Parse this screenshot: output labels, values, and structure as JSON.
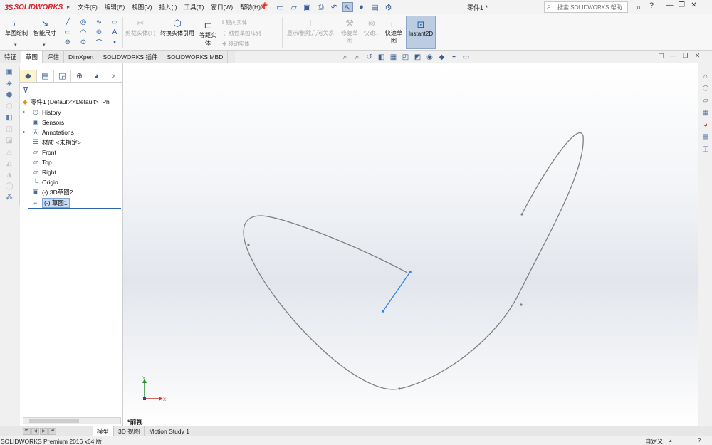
{
  "app": {
    "logo_text": "SOLIDWORKS",
    "doc_title": "零件1 *",
    "search_placeholder": "搜索 SOLIDWORKS 帮助"
  },
  "menus": [
    "文件(F)",
    "编辑(E)",
    "视图(V)",
    "插入(I)",
    "工具(T)",
    "窗口(W)",
    "帮助(H)"
  ],
  "commands": {
    "sketch": "草图绘制",
    "smart_dim": "智能尺寸",
    "trim": "剪裁实体(T)",
    "convert": "转换实体引用",
    "offset_line1": "等距实",
    "offset_line2": "体",
    "mirror": "镜向实体",
    "linear_pattern": "线性草图阵列",
    "move": "移动实体",
    "show_relations": "显示/删除几何关系",
    "repair_line1": "修复草",
    "repair_line2": "图",
    "quick_snaps": "快速...",
    "rapid_line1": "快速草",
    "rapid_line2": "图",
    "instant2d": "Instant2D"
  },
  "tabs": [
    {
      "label": "特征",
      "active": false
    },
    {
      "label": "草图",
      "active": true
    },
    {
      "label": "评估",
      "active": false
    },
    {
      "label": "DimXpert",
      "active": false
    },
    {
      "label": "SOLIDWORKS 插件",
      "active": false
    },
    {
      "label": "SOLIDWORKS MBD",
      "active": false
    }
  ],
  "feature_tree": {
    "root": "零件1  (Default<<Default>_Ph",
    "items": [
      {
        "label": "History",
        "expandable": true,
        "icon": "history-icon"
      },
      {
        "label": "Sensors",
        "expandable": false,
        "icon": "sensors-icon"
      },
      {
        "label": "Annotations",
        "expandable": true,
        "icon": "annotations-icon"
      },
      {
        "label": "材质 <未指定>",
        "expandable": false,
        "icon": "material-icon"
      },
      {
        "label": "Front",
        "expandable": false,
        "icon": "plane-icon"
      },
      {
        "label": "Top",
        "expandable": false,
        "icon": "plane-icon"
      },
      {
        "label": "Right",
        "expandable": false,
        "icon": "plane-icon"
      },
      {
        "label": "Origin",
        "expandable": false,
        "icon": "origin-icon"
      },
      {
        "label": "(-) 3D草图2",
        "expandable": false,
        "icon": "3d-sketch-icon"
      },
      {
        "label": "(-) 草图1",
        "expandable": false,
        "icon": "sketch-icon",
        "selected": true
      }
    ]
  },
  "viewport": {
    "view_label": "*前视",
    "triad_y": "Y",
    "triad_x": "X"
  },
  "sketch_data": {
    "spline": [
      [
        176,
        212
      ],
      [
        200,
        222
      ],
      [
        260,
        238
      ],
      [
        330,
        260
      ],
      [
        402,
        294
      ],
      [
        480,
        336
      ],
      [
        545,
        342
      ],
      [
        590,
        288
      ],
      [
        640,
        210
      ],
      [
        660,
        138
      ],
      [
        647,
        96
      ],
      [
        605,
        122
      ],
      [
        560,
        212
      ]
    ],
    "spline_points": [
      [
        176,
        256
      ],
      [
        388,
        458
      ],
      [
        559,
        340
      ],
      [
        560,
        212
      ]
    ],
    "line": [
      [
        403,
        294
      ],
      [
        365,
        349
      ]
    ],
    "line_points": [
      [
        403,
        294
      ],
      [
        365,
        349
      ]
    ]
  },
  "bottom_tabs": [
    {
      "label": "模型",
      "active": true
    },
    {
      "label": "3D 视图",
      "active": false
    },
    {
      "label": "Motion Study 1",
      "active": false
    }
  ],
  "status": {
    "text": "SOLIDWORKS Premium 2016 x64 版",
    "unit": "自定义"
  },
  "colors": {
    "accent": "#2f66b3",
    "brand": "#d8202a",
    "sketch_curve": "#7f7f7f",
    "sketch_selected": "#2f86e0"
  }
}
